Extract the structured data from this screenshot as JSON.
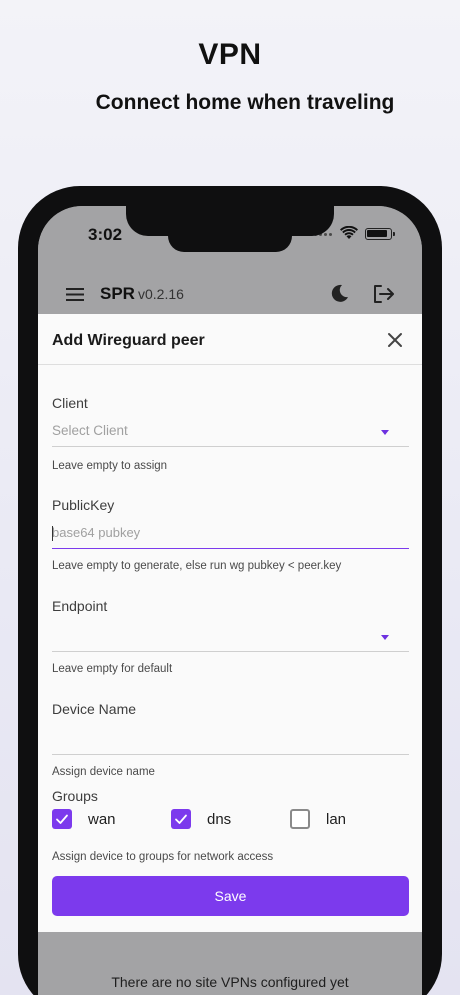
{
  "promo": {
    "title": "VPN",
    "subtitle": "Connect home when traveling"
  },
  "status_bar": {
    "time": "3:02"
  },
  "app_bar": {
    "name": "SPR",
    "version": "v0.2.16",
    "icons": [
      "menu-icon",
      "moon-icon",
      "logout-icon"
    ]
  },
  "modal": {
    "title": "Add Wireguard peer",
    "close_icon": "close-icon",
    "client": {
      "label": "Client",
      "placeholder": "Select Client",
      "helper": "Leave empty to assign"
    },
    "public_key": {
      "label": "PublicKey",
      "placeholder": "base64 pubkey",
      "helper": "Leave empty to generate, else run wg pubkey < peer.key"
    },
    "endpoint": {
      "label": "Endpoint",
      "value": "",
      "helper": "Leave empty for default"
    },
    "device_name": {
      "label": "Device Name",
      "value": "",
      "helper": "Assign device name"
    },
    "groups": {
      "label": "Groups",
      "options": [
        {
          "name": "wan",
          "checked": true
        },
        {
          "name": "dns",
          "checked": true
        },
        {
          "name": "lan",
          "checked": false
        }
      ],
      "helper": "Assign device to groups for network access"
    },
    "save_label": "Save"
  },
  "background_page": {
    "empty_message": "There are no site VPNs configured yet"
  },
  "colors": {
    "accent": "#7c3aed",
    "overlay": "#a3a3a5",
    "modal_bg": "#fafafa"
  }
}
